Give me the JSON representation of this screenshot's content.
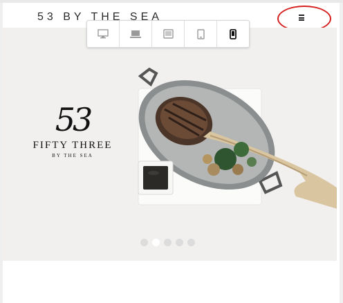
{
  "site": {
    "brand": "53 BY THE SEA"
  },
  "menu": {
    "icon": "hamburger-icon"
  },
  "device_toolbar": {
    "devices": [
      {
        "name": "desktop-icon",
        "active": false
      },
      {
        "name": "laptop-icon",
        "active": false
      },
      {
        "name": "tablet-landscape-icon",
        "active": false
      },
      {
        "name": "tablet-portrait-icon",
        "active": false
      },
      {
        "name": "mobile-icon",
        "active": true
      }
    ]
  },
  "hero": {
    "logo_number": "53",
    "logo_name": "FIFTY THREE",
    "logo_sub": "BY THE SEA",
    "image": "steak-platter-photo"
  },
  "slider": {
    "count": 5,
    "active_index": 1
  },
  "colors": {
    "highlight": "#d62020",
    "hero_bg": "#f1f0ef"
  }
}
